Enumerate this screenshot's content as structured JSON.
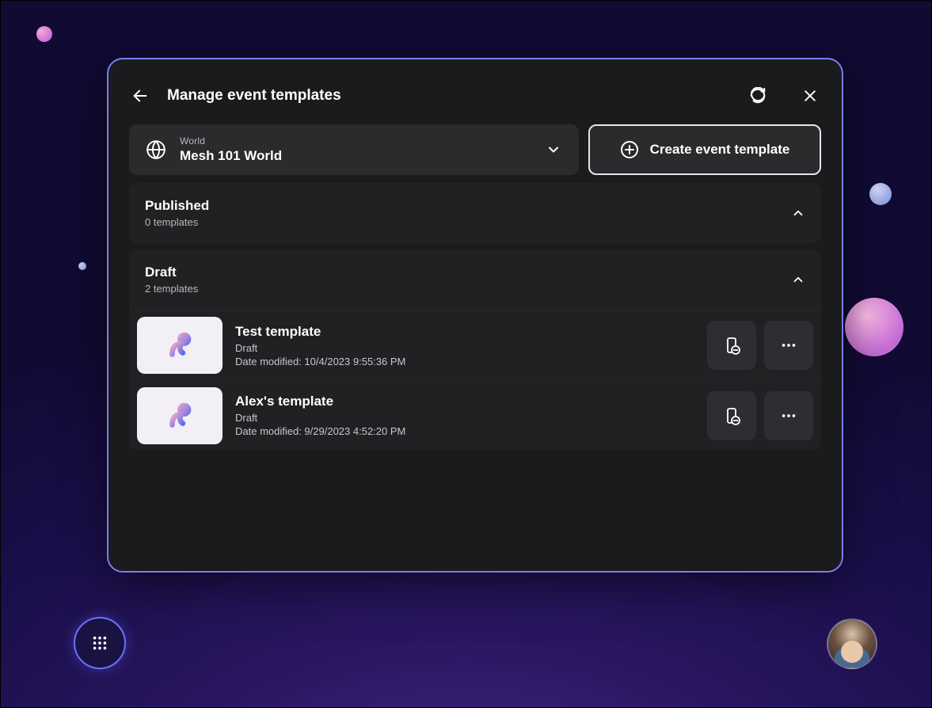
{
  "dialog": {
    "title": "Manage event templates",
    "world_label": "World",
    "world_value": "Mesh 101 World",
    "create_label": "Create event template"
  },
  "sections": [
    {
      "title": "Published",
      "subtitle": "0 templates",
      "items": []
    },
    {
      "title": "Draft",
      "subtitle": "2 templates",
      "items": [
        {
          "name": "Test template",
          "status": "Draft",
          "date_modified": "Date modified: 10/4/2023 9:55:36 PM"
        },
        {
          "name": "Alex's template",
          "status": "Draft",
          "date_modified": "Date modified: 9/29/2023 4:52:20 PM"
        }
      ]
    }
  ]
}
